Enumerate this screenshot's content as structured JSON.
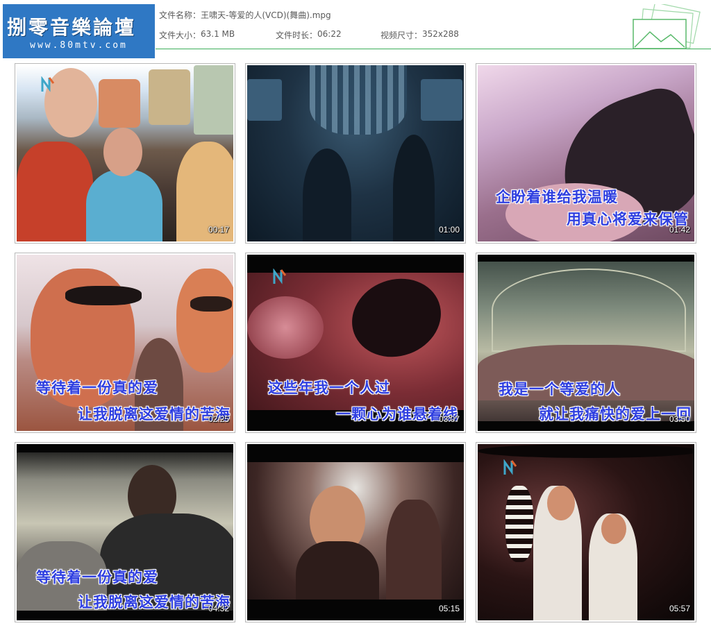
{
  "header": {
    "logo_title": "捌零音樂論壇",
    "logo_url": "www.80mtv.com",
    "file_name_label": "文件名称：",
    "file_name": "王啸天-等爱的人(VCD)(舞曲).mpg",
    "file_size_label": "文件大小：",
    "file_size": "63.1 MB",
    "duration_label": "文件时长：",
    "duration": "06:22",
    "video_size_label": "视频尺寸：",
    "video_size": "352x288"
  },
  "thumbnails": [
    {
      "time": "00:17",
      "lyric1": "",
      "lyric2": ""
    },
    {
      "time": "01:00",
      "lyric1": "",
      "lyric2": ""
    },
    {
      "time": "01:42",
      "lyric1": "企盼着谁给我温暖",
      "lyric2": "用真心将爱来保管"
    },
    {
      "time": "02:25",
      "lyric1": "等待着一份真的爱",
      "lyric2": "让我脱离这爱情的苦海"
    },
    {
      "time": "03:07",
      "lyric1": "这些年我一个人过",
      "lyric2": "一颗心为谁悬着线"
    },
    {
      "time": "03:50",
      "lyric1": "我是一个等爱的人",
      "lyric2": "就让我痛快的爱上一回"
    },
    {
      "time": "04:32",
      "lyric1": "等待着一份真的爱",
      "lyric2": "让我脱离这爱情的苦海"
    },
    {
      "time": "05:15",
      "lyric1": "",
      "lyric2": ""
    },
    {
      "time": "05:57",
      "lyric1": "",
      "lyric2": ""
    }
  ],
  "colors": {
    "logo_bg": "#2f78c4",
    "rule": "#3cae5a",
    "lyric": "#2f3fe0"
  }
}
